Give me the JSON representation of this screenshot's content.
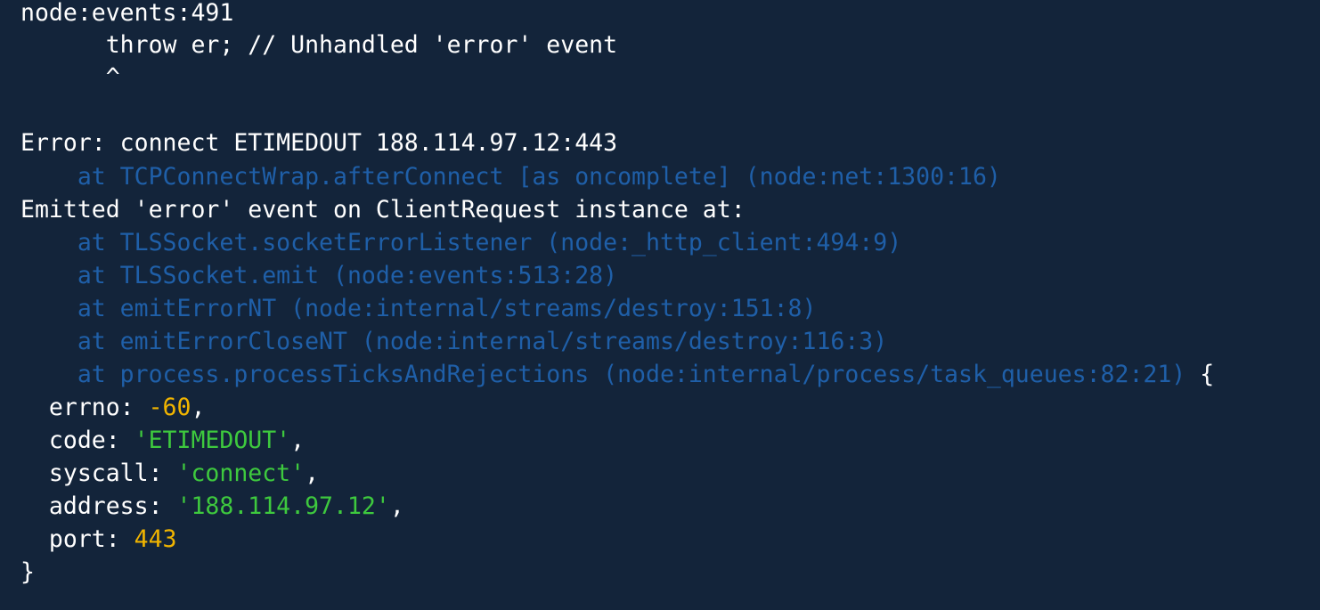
{
  "terminal": {
    "colors": {
      "background": "#13243a",
      "default_text": "#ffffff",
      "stack_frame": "#1f5fa8",
      "number": "#f0b400",
      "string": "#3ec93e"
    },
    "header": {
      "location": "node:events:491",
      "source_line": "      throw er; // Unhandled 'error' event",
      "caret": "      ^"
    },
    "error": {
      "message": "Error: connect ETIMEDOUT 188.114.97.12:443",
      "frame_1": "    at TCPConnectWrap.afterConnect [as oncomplete] (node:net:1300:16)"
    },
    "emitted": {
      "message": "Emitted 'error' event on ClientRequest instance at:",
      "frames": [
        "    at TLSSocket.socketErrorListener (node:_http_client:494:9)",
        "    at TLSSocket.emit (node:events:513:28)",
        "    at emitErrorNT (node:internal/streams/destroy:151:8)",
        "    at emitErrorCloseNT (node:internal/streams/destroy:116:3)",
        "    at process.processTicksAndRejections (node:internal/process/task_queues:82:21)"
      ],
      "open_brace": " {"
    },
    "details": {
      "errno_key": "  errno: ",
      "errno_value": "-60",
      "code_key": "  code: ",
      "code_value": "'ETIMEDOUT'",
      "syscall_key": "  syscall: ",
      "syscall_value": "'connect'",
      "address_key": "  address: ",
      "address_value": "'188.114.97.12'",
      "port_key": "  port: ",
      "port_value": "443",
      "comma": ",",
      "close_brace": "}"
    }
  }
}
